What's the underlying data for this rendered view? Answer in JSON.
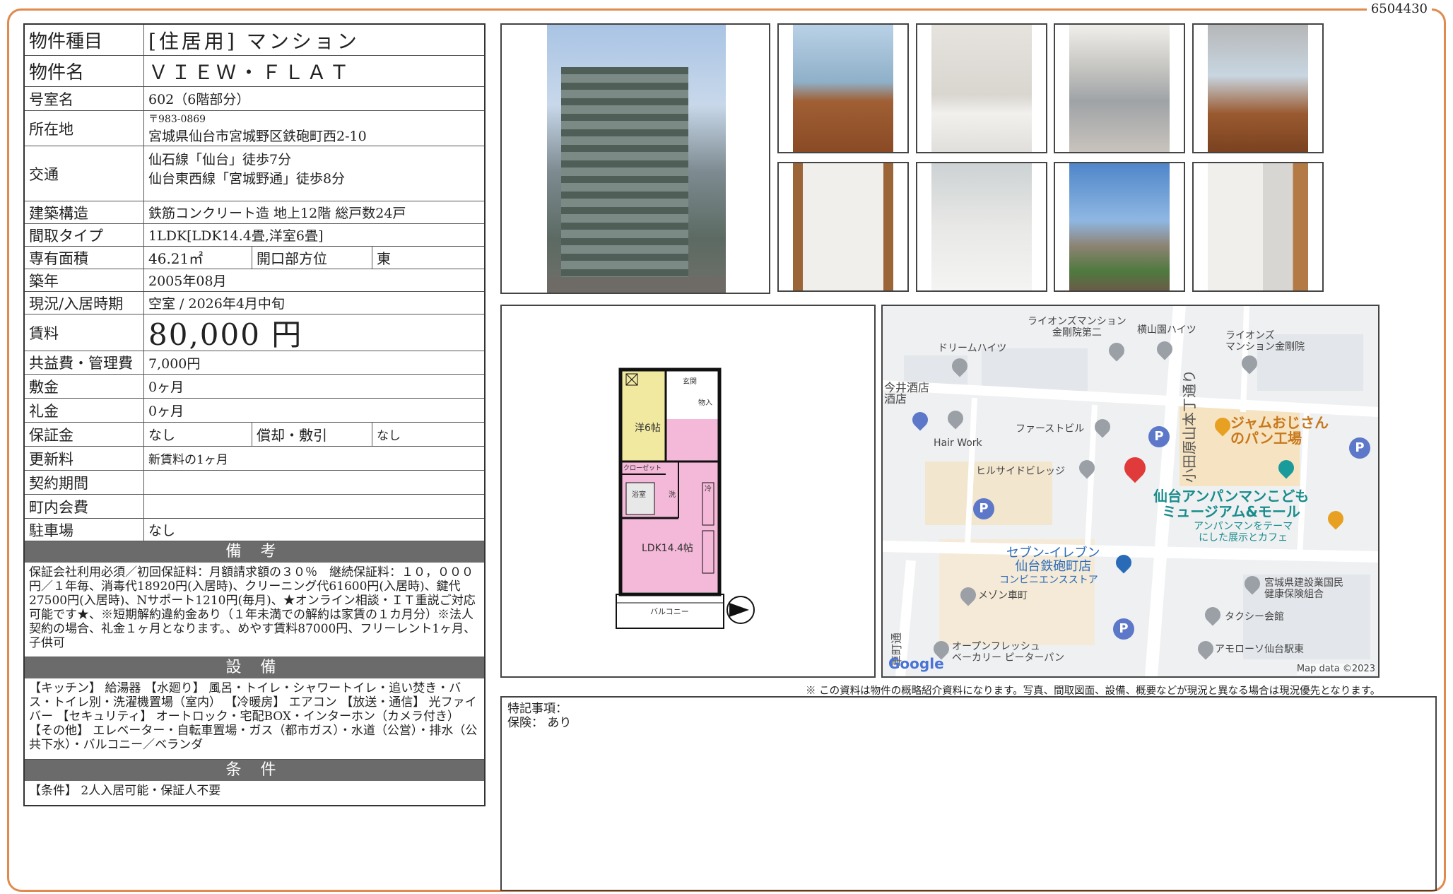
{
  "doc_id": "6504430",
  "property": {
    "type_label": "物件種目",
    "type_value": "[住居用] マンション",
    "name_label": "物件名",
    "name_value": "ＶＩＥＷ・ＦＬＡＴ",
    "room_label": "号室名",
    "room_value": "602（6階部分）",
    "address_label": "所在地",
    "postal": "〒983-0869",
    "address": "宮城県仙台市宮城野区鉄砲町西2-10",
    "access_label": "交通",
    "access_1": "仙石線「仙台」徒歩7分",
    "access_2": "仙台東西線「宮城野通」徒歩8分",
    "structure_label": "建築構造",
    "structure_value": "鉄筋コンクリート造 地上12階 総戸数24戸",
    "layout_label": "間取タイプ",
    "layout_value": "1LDK[LDK14.4畳,洋室6畳]",
    "area_label": "専有面積",
    "area_value": "46.21㎡",
    "direction_label": "開口部方位",
    "direction_value": "東",
    "built_label": "築年",
    "built_value": "2005年08月",
    "status_label": "現況/入居時期",
    "status_value": "空室 / 2026年4月中旬",
    "rent_label": "賃料",
    "rent_value": "80,000 円",
    "fee_label": "共益費・管理費",
    "fee_value": "7,000円",
    "deposit_label": "敷金",
    "deposit_value": "0ヶ月",
    "key_label": "礼金",
    "key_value": "0ヶ月",
    "guarantee_label": "保証金",
    "guarantee_value": "なし",
    "amort_label": "償却・敷引",
    "amort_value": "なし",
    "renewal_label": "更新料",
    "renewal_value": "新賃料の1ヶ月",
    "contract_label": "契約期間",
    "contract_value": "",
    "council_label": "町内会費",
    "council_value": "",
    "parking_label": "駐車場",
    "parking_value": "なし"
  },
  "remarks": {
    "title": "備 考",
    "text": "保証会社利用必須／初回保証料：月額請求額の３０％　継続保証料：１０，０００円／１年毎、消毒代18920円(入居時)、クリーニング代61600円(入居時)、鍵代27500円(入居時)、Nサポート1210円(毎月)、★オンライン相談・ＩＴ重説ご対応可能です★、※短期解約違約金あり（１年未満での解約は家賃の１カ月分）※法人契約の場合、礼金１ヶ月となります。、めやす賃料87000円、フリーレント1ヶ月、子供可"
  },
  "equipment": {
    "title": "設 備",
    "text": "【キッチン】 給湯器 【水廻り】 風呂・トイレ・シャワートイレ・追い焚き・バス・トイレ別・洗濯機置場（室内） 【冷暖房】 エアコン 【放送・通信】 光ファイバー 【セキュリティ】 オートロック・宅配BOX・インターホン（カメラ付き） 【その他】 エレベーター・自転車置場・ガス（都市ガス）・水道（公営）・排水（公共下水）・バルコニー／ベランダ"
  },
  "conditions": {
    "title": "条 件",
    "text": "【条件】 2人入居可能・保証人不要"
  },
  "floorplan": {
    "room1": "洋6帖",
    "ldk": "LDK14.4帖",
    "closet": "クローゼット",
    "bath": "浴室",
    "wash": "洗",
    "entry": "玄関",
    "storage": "物入",
    "fridge": "冷",
    "balcony": "バルコニー"
  },
  "map": {
    "labels": {
      "l1": "ライオンズマンション\n金剛院第二",
      "l2": "横山園ハイツ",
      "l3": "ライオンズ\nマンション金剛院",
      "l4": "ドリームハイツ",
      "l5": "今井酒店\n酒店",
      "l6": "Hair Work",
      "l7": "ファーストビル",
      "l8": "ヒルサイドビレッジ",
      "l9": "ジャムおじさん\nのパン工場",
      "l10": "仙台アンパンマンこども\nミュージアム&モール",
      "l11": "アンパンマンをテーマ\nにした展示とカフェ",
      "l12": "セブン-イレブン\n仙台鉄砲町店",
      "l13": "コンビニエンスストア",
      "l14": "メゾン車町",
      "l15": "宮城県建設業国民\n健康保険組合",
      "l16": "タクシー会館",
      "l17": "オープンフレッシュ\nベーカリー ピーターパン",
      "l18": "アモローソ仙台駅東",
      "l19": "小田原山本丁通り",
      "l20": "車町通"
    },
    "google": "Google",
    "mapdata": "Map data ©2023",
    "pin_color": "#e03a3a",
    "parking_letter": "P"
  },
  "disclaimer": "※ この資料は物件の概略紹介資料になります。写真、間取図面、設備、概要などが現況と異なる場合は現況優先となります。",
  "special": {
    "line1": "特記事項：",
    "line2": "保険： あり"
  },
  "colors": {
    "frame": "#e08a4e",
    "band": "#6b6b6b",
    "ldk": "#f4b8d8",
    "room": "#f2e9a0"
  }
}
